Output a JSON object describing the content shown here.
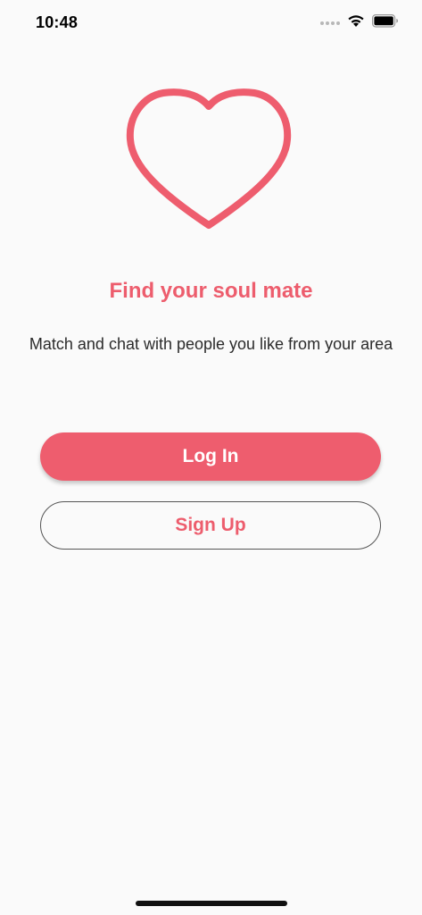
{
  "status_bar": {
    "time": "10:48",
    "icons": [
      "signal-dots-icon",
      "wifi-icon",
      "battery-icon"
    ]
  },
  "hero": {
    "icon": "heart-outline-icon",
    "accent_color": "#ee5d6e"
  },
  "title": "Find your soul mate",
  "subtitle": "Match and chat with people you like from your area",
  "buttons": {
    "login_label": "Log In",
    "signup_label": "Sign Up"
  }
}
